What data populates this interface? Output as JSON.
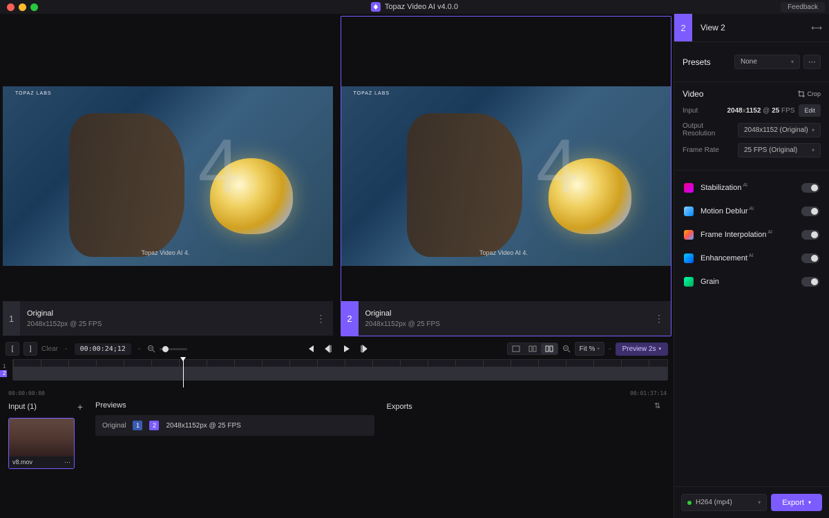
{
  "titlebar": {
    "app": "Topaz Video AI  v4.0.0",
    "feedback": "Feedback"
  },
  "panes": [
    {
      "num": "1",
      "title": "Original",
      "meta": "2048x1152px @ 25 FPS",
      "watermark_top": "TOPAZ LABS",
      "watermark_bottom": "Topaz Video AI 4."
    },
    {
      "num": "2",
      "title": "Original",
      "meta": "2048x1152px @ 25 FPS",
      "watermark_top": "TOPAZ LABS",
      "watermark_bottom": "Topaz Video AI 4."
    }
  ],
  "controls": {
    "clear": "Clear",
    "dash": "-",
    "timecode": "00:00:24;12",
    "fit": "Fit %",
    "preview_btn": "Preview 2s"
  },
  "timeline": {
    "lane1": "1",
    "lane2": "2",
    "start": "00:00:00:00",
    "end": "00:01:37:14"
  },
  "lower": {
    "input_title": "Input (1)",
    "thumb_name": "v8.mov",
    "previews_title": "Previews",
    "prev_label": "Original",
    "prev_meta": "2048x1152px @ 25 FPS",
    "exports_title": "Exports"
  },
  "right": {
    "num": "2",
    "title": "View 2",
    "presets_label": "Presets",
    "presets_value": "None",
    "video_label": "Video",
    "crop": "Crop",
    "input_label": "Input",
    "input_value_a": "2048",
    "input_x": "x",
    "input_value_b": "1152",
    "input_at": " @ ",
    "input_fps": "25",
    "input_fps_lbl": " FPS",
    "edit": "Edit",
    "outres_label": "Output Resolution",
    "outres_value": "2048x1152 (Original)",
    "framerate_label": "Frame Rate",
    "framerate_value": "25 FPS (Original)",
    "filters": [
      {
        "name": "Stabilization",
        "ai": true
      },
      {
        "name": "Motion Deblur",
        "ai": true
      },
      {
        "name": "Frame Interpolation",
        "ai": true
      },
      {
        "name": "Enhancement",
        "ai": true
      },
      {
        "name": "Grain",
        "ai": false
      }
    ],
    "codec": "H264 (mp4)",
    "export": "Export"
  }
}
